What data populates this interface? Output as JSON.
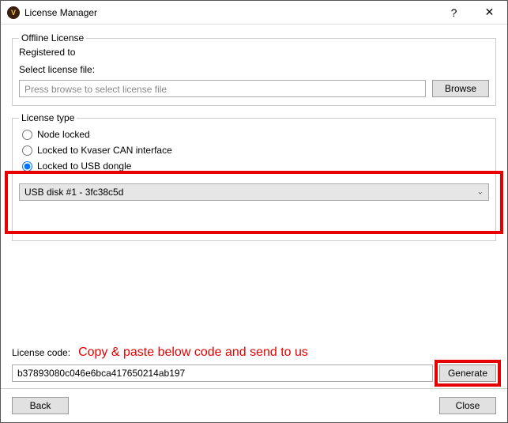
{
  "window": {
    "title": "License Manager"
  },
  "offline": {
    "legend": "Offline License",
    "registered_label": "Registered to",
    "select_label": "Select license file:",
    "file_placeholder": "Press browse to select license file",
    "browse_label": "Browse"
  },
  "license_type": {
    "legend": "License type",
    "options": {
      "node_locked": "Node locked",
      "kvaser": "Locked to Kvaser CAN interface",
      "usb_dongle": "Locked to USB dongle"
    },
    "selected": "usb_dongle",
    "usb_select_value": "USB disk #1 - 3fc38c5d"
  },
  "code": {
    "label": "License code:",
    "instruction": "Copy & paste below code and send to us",
    "value": "b37893080c046e6bca417650214ab197",
    "generate_label": "Generate"
  },
  "footer": {
    "back_label": "Back",
    "close_label": "Close"
  }
}
